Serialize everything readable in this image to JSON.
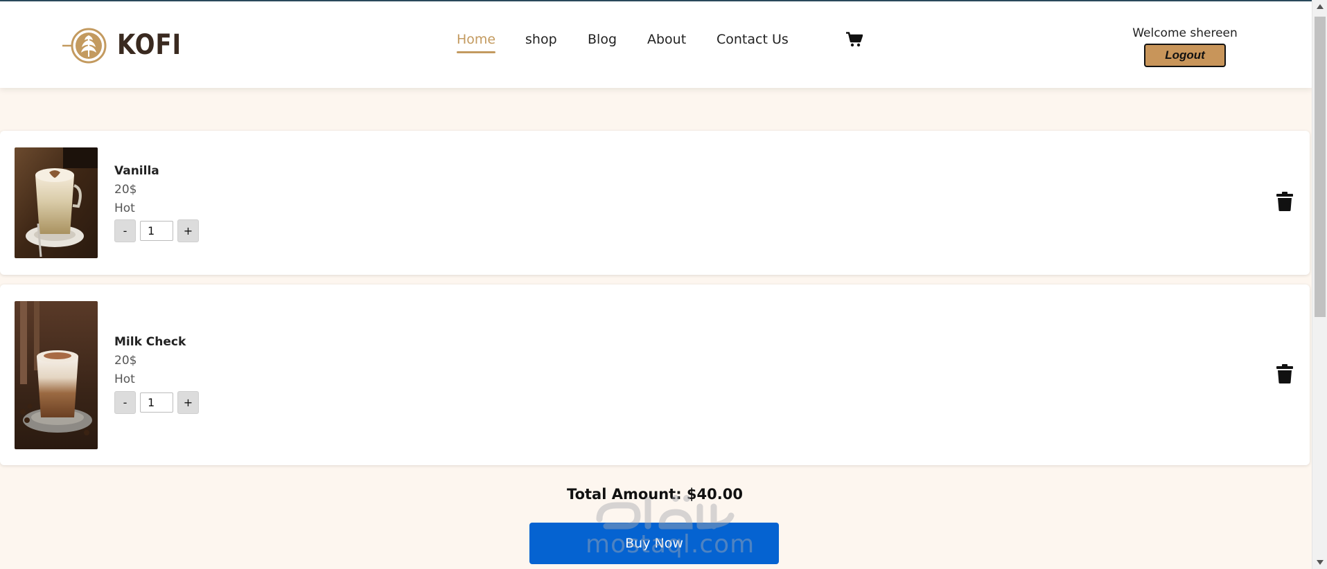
{
  "brand": {
    "name": "KOFI",
    "logo_icon": "coffee-cup-latte-art-icon"
  },
  "nav": {
    "items": [
      {
        "label": "Home",
        "active": true
      },
      {
        "label": "shop",
        "active": false
      },
      {
        "label": "Blog",
        "active": false
      },
      {
        "label": "About",
        "active": false
      },
      {
        "label": "Contact Us",
        "active": false
      }
    ],
    "cart_icon": "shopping-cart-icon"
  },
  "user": {
    "welcome": "Welcome shereen",
    "logout_label": "Logout"
  },
  "cart": {
    "items": [
      {
        "name": "Vanilla",
        "price": "20$",
        "temperature": "Hot",
        "quantity": "1",
        "minus_label": "-",
        "plus_label": "+",
        "image": "vanilla-latte-photo"
      },
      {
        "name": "Milk Check",
        "price": "20$",
        "temperature": "Hot",
        "quantity": "1",
        "minus_label": "-",
        "plus_label": "+",
        "image": "milk-coffee-glass-photo"
      }
    ],
    "total_label": "Total Amount: $40.00",
    "buy_label": "Buy Now"
  },
  "watermark": {
    "text": "mostaql.com"
  },
  "colors": {
    "accent": "#c39a5f",
    "logout_bg": "#c8955a",
    "buy_bg": "#0563d1",
    "page_bg": "#fdf6ef"
  }
}
